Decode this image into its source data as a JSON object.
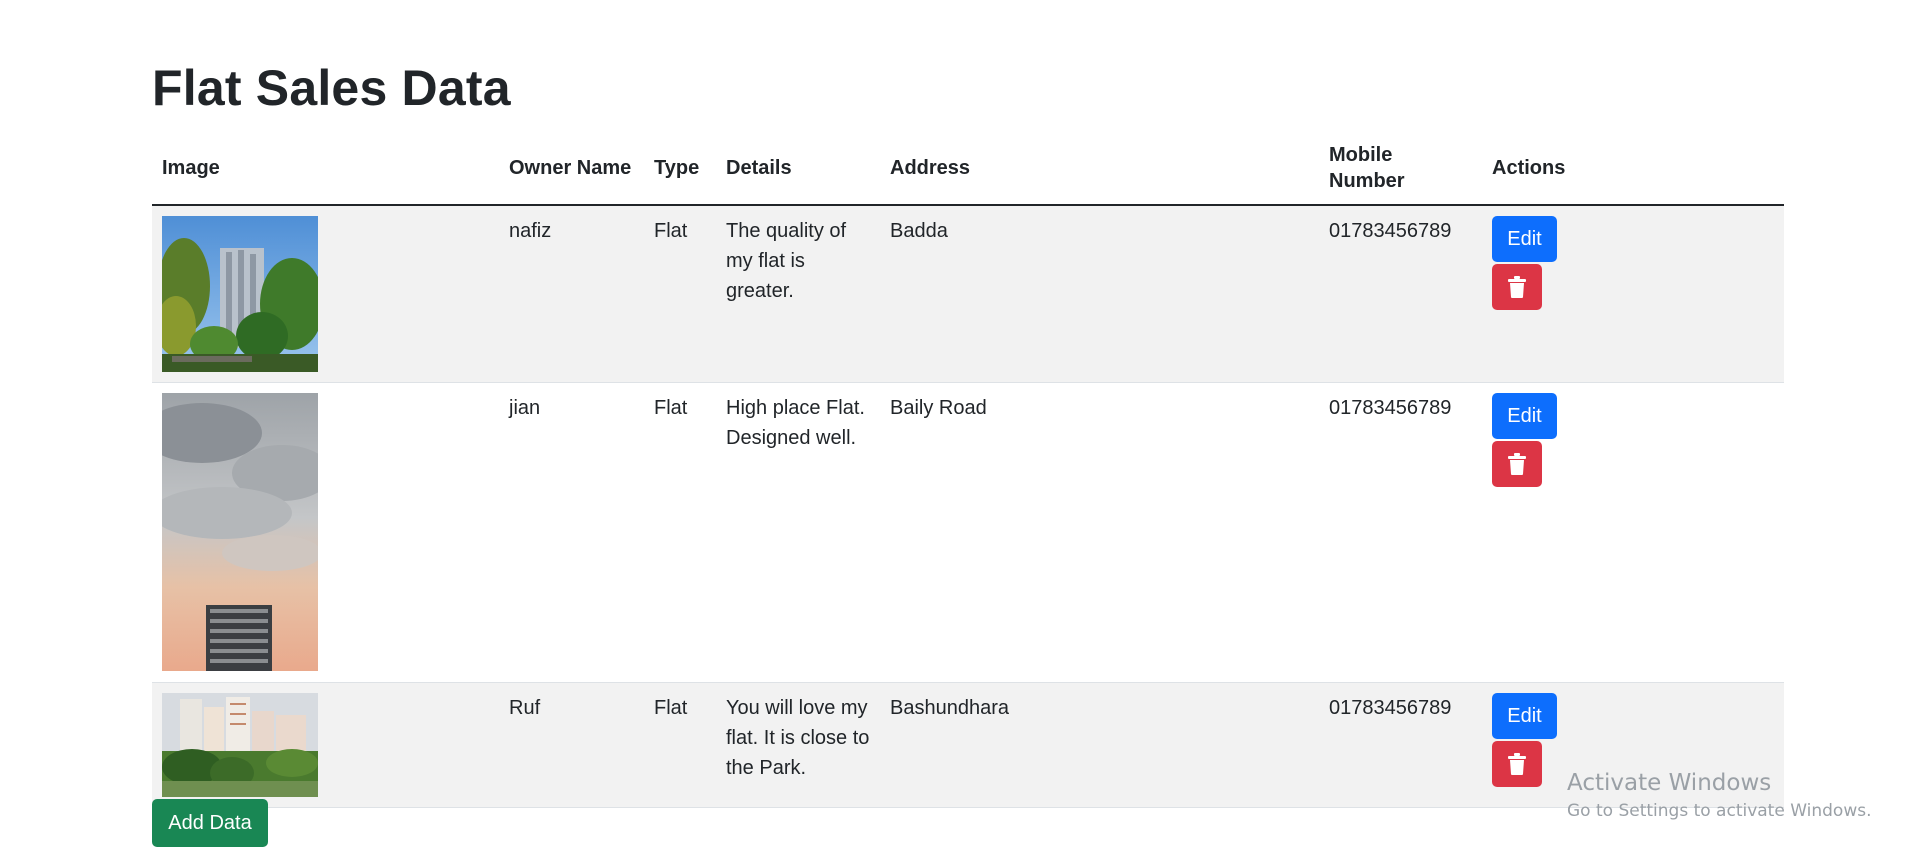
{
  "page": {
    "title": "Flat Sales Data"
  },
  "table": {
    "headers": {
      "image": "Image",
      "owner": "Owner Name",
      "type": "Type",
      "details": "Details",
      "address": "Address",
      "mobile": "Mobile Number",
      "actions": "Actions"
    },
    "rows": [
      {
        "image": "apartment-tower-trees-photo",
        "owner": "nafiz",
        "type": "Flat",
        "details": "The quality of my flat is greater.",
        "address": "Badda",
        "mobile": "01783456789",
        "edit_label": "Edit",
        "delete_icon": "trash-icon"
      },
      {
        "image": "cloudy-sky-highrise-photo",
        "owner": "jian",
        "type": "Flat",
        "details": "High place Flat. Designed well.",
        "address": "Baily Road",
        "mobile": "01783456789",
        "edit_label": "Edit",
        "delete_icon": "trash-icon"
      },
      {
        "image": "apartment-complex-park-photo",
        "owner": "Ruf",
        "type": "Flat",
        "details": "You will love my flat. It is close to the Park.",
        "address": "Bashundhara",
        "mobile": "01783456789",
        "edit_label": "Edit",
        "delete_icon": "trash-icon"
      }
    ]
  },
  "actions": {
    "add_label": "Add Data"
  },
  "watermark": {
    "title": "Activate Windows",
    "subtitle": "Go to Settings to activate Windows."
  },
  "colors": {
    "edit": "#0d6efd",
    "delete": "#dc3545",
    "add": "#198754",
    "stripe": "#f2f2f2"
  }
}
